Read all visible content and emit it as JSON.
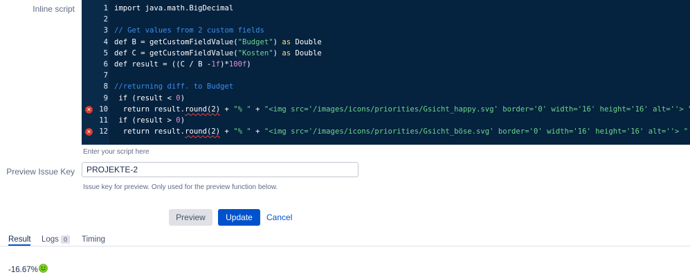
{
  "form": {
    "inline_script_label": "Inline script",
    "script_help": "Enter your script here",
    "preview_key_label": "Preview Issue Key",
    "preview_key_value": "PROJEKTE-2",
    "preview_key_help": "Issue key for preview. Only used for the preview function below."
  },
  "editor": {
    "line_numbers": [
      "1",
      "2",
      "3",
      "4",
      "5",
      "6",
      "7",
      "8",
      "9",
      "10",
      "11",
      "12"
    ],
    "lines": [
      {
        "n": "1",
        "error": false,
        "tokens": [
          {
            "t": "import java.math.BigDecimal",
            "c": "plain"
          }
        ]
      },
      {
        "n": "2",
        "error": false,
        "tokens": []
      },
      {
        "n": "3",
        "error": false,
        "tokens": [
          {
            "t": "// Get values from 2 custom fields",
            "c": "comment"
          }
        ]
      },
      {
        "n": "4",
        "error": false,
        "tokens": [
          {
            "t": "def B = getCustomFieldValue(",
            "c": "plain"
          },
          {
            "t": "\"Budget\"",
            "c": "string"
          },
          {
            "t": ") ",
            "c": "plain"
          },
          {
            "t": "as",
            "c": "keyword"
          },
          {
            "t": " Double",
            "c": "plain"
          }
        ]
      },
      {
        "n": "5",
        "error": false,
        "tokens": [
          {
            "t": "def C = getCustomFieldValue(",
            "c": "plain"
          },
          {
            "t": "\"Kosten\"",
            "c": "string"
          },
          {
            "t": ") ",
            "c": "plain"
          },
          {
            "t": "as",
            "c": "keyword"
          },
          {
            "t": " Double",
            "c": "plain"
          }
        ]
      },
      {
        "n": "6",
        "error": false,
        "tokens": [
          {
            "t": "def result = ((C / B -",
            "c": "plain"
          },
          {
            "t": "1f",
            "c": "num"
          },
          {
            "t": ")*",
            "c": "plain"
          },
          {
            "t": "100f",
            "c": "num"
          },
          {
            "t": ")",
            "c": "plain"
          }
        ]
      },
      {
        "n": "7",
        "error": false,
        "tokens": []
      },
      {
        "n": "8",
        "error": false,
        "tokens": [
          {
            "t": "//returning diff. to Budget",
            "c": "comment"
          }
        ]
      },
      {
        "n": "9",
        "error": false,
        "tokens": [
          {
            "t": " if (result < ",
            "c": "plain"
          },
          {
            "t": "0",
            "c": "num"
          },
          {
            "t": ")",
            "c": "plain"
          }
        ]
      },
      {
        "n": "10",
        "error": true,
        "tokens": [
          {
            "t": "  return result.",
            "c": "plain"
          },
          {
            "t": "round(2)",
            "c": "squiggle"
          },
          {
            "t": " + ",
            "c": "plain"
          },
          {
            "t": "\"% \"",
            "c": "string"
          },
          {
            "t": " + ",
            "c": "plain"
          },
          {
            "t": "\"<img src='/images/icons/priorities/Gsicht_happy.svg' border='0' width='16' height='16' alt=''> \"",
            "c": "string"
          }
        ]
      },
      {
        "n": "11",
        "error": false,
        "tokens": [
          {
            "t": " if (result > ",
            "c": "plain"
          },
          {
            "t": "0",
            "c": "num"
          },
          {
            "t": ")",
            "c": "plain"
          }
        ]
      },
      {
        "n": "12",
        "error": true,
        "tokens": [
          {
            "t": "  return result.",
            "c": "plain"
          },
          {
            "t": "round(2)",
            "c": "squiggle"
          },
          {
            "t": " + ",
            "c": "plain"
          },
          {
            "t": "\"% \"",
            "c": "string"
          },
          {
            "t": " + ",
            "c": "plain"
          },
          {
            "t": "\"<img src='/images/icons/priorities/Gsicht_böse.svg' border='0' width='16' height='16' alt=''> \"",
            "c": "string"
          }
        ]
      }
    ],
    "colors": {
      "background": "#05223f",
      "comment": "#3d8ee8",
      "keyword": "#f3e27a",
      "string": "#6fd58c",
      "number": "#e98cd6",
      "error": "#d83a2a"
    }
  },
  "buttons": {
    "preview": "Preview",
    "update": "Update",
    "cancel": "Cancel"
  },
  "tabs": {
    "result": "Result",
    "logs": "Logs",
    "logs_count": "0",
    "timing": "Timing"
  },
  "result": {
    "value": "-16.67%",
    "icon": "happy-face-icon"
  },
  "accent_color": "#0052cc"
}
